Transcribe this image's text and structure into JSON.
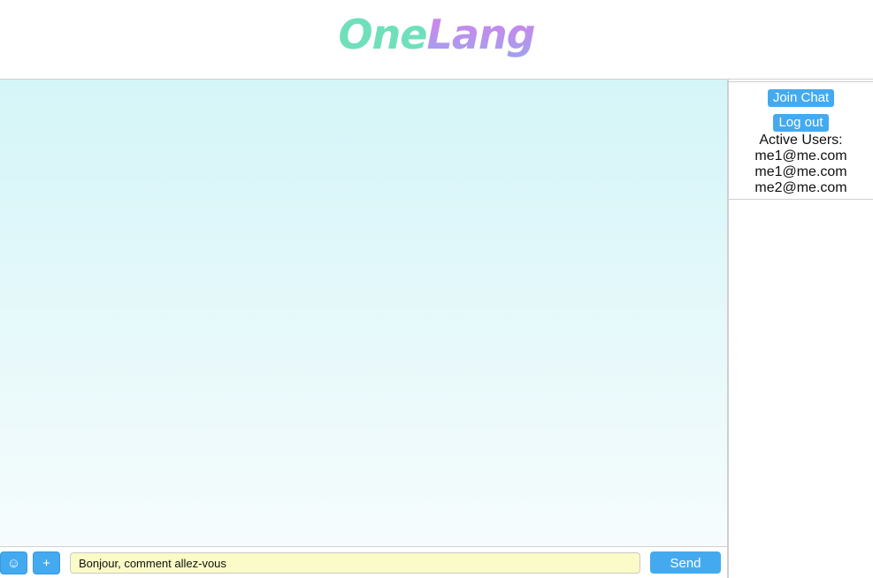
{
  "app": {
    "logo_part1": "One",
    "logo_part2": "Lang"
  },
  "composer": {
    "emoji_icon": "☺",
    "plus_icon": "+",
    "message_value": "Bonjour, comment allez-vous",
    "send_label": "Send"
  },
  "sidebar": {
    "join_label": "Join Chat",
    "logout_label": "Log out",
    "users_title": "Active Users:",
    "users": [
      "me1@me.com",
      "me1@me.com",
      "me2@me.com"
    ]
  },
  "colors": {
    "accent": "#44aaf0",
    "input_bg": "#fafbc6",
    "chat_bg_top": "#d4f5f8"
  }
}
